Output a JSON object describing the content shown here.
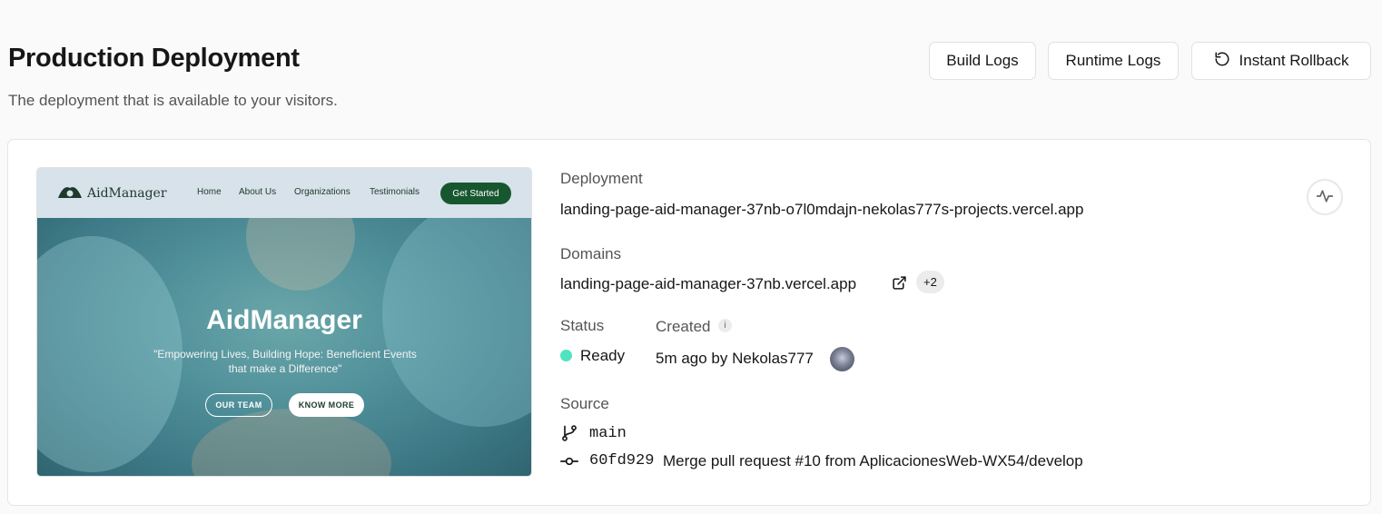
{
  "header": {
    "title": "Production Deployment",
    "subtitle": "The deployment that is available to your visitors."
  },
  "actions": {
    "build_logs": "Build Logs",
    "runtime_logs": "Runtime Logs",
    "instant_rollback": "Instant Rollback"
  },
  "preview": {
    "logo_text": "AidManager",
    "nav_links": [
      "Home",
      "About Us",
      "Organizations",
      "Testimonials"
    ],
    "cta": "Get Started",
    "hero_title": "AidManager",
    "hero_subtitle": "\"Empowering Lives, Building Hope: Beneficient Events that make a Difference\"",
    "btn_team": "OUR TEAM",
    "btn_more": "KNOW MORE"
  },
  "deployment": {
    "label": "Deployment",
    "url": "landing-page-aid-manager-37nb-o7l0mdajn-nekolas777s-projects.vercel.app"
  },
  "domains": {
    "label": "Domains",
    "primary": "landing-page-aid-manager-37nb.vercel.app",
    "extra_count": "+2"
  },
  "status": {
    "label": "Status",
    "value": "Ready",
    "color": "#50e3c2"
  },
  "created": {
    "label": "Created",
    "info": "i",
    "value": "5m ago by Nekolas777"
  },
  "source": {
    "label": "Source",
    "branch": "main",
    "commit_hash": "60fd929",
    "commit_message": "Merge pull request #10 from AplicacionesWeb-WX54/develop"
  }
}
